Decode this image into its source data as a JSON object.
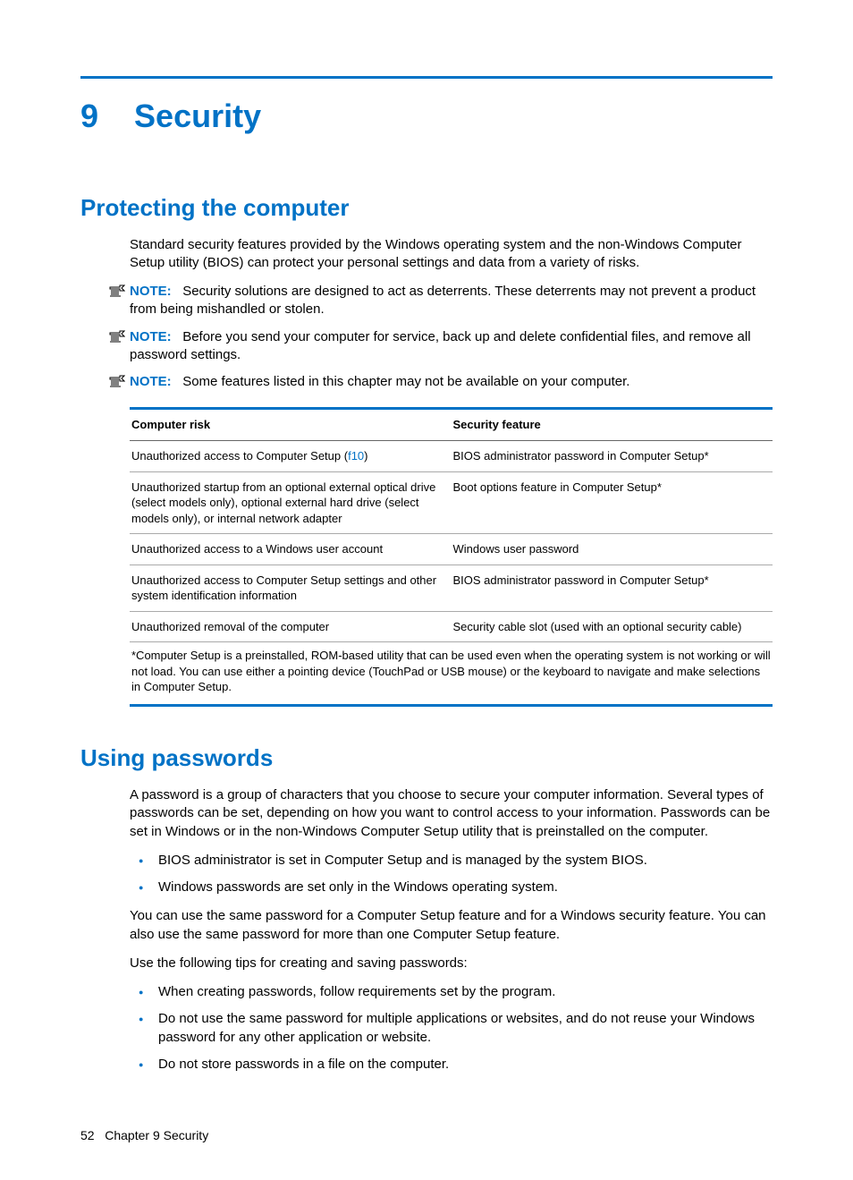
{
  "chapter": {
    "number": "9",
    "title": "Security"
  },
  "section1": {
    "heading": "Protecting the computer",
    "intro": "Standard security features provided by the Windows operating system and the non-Windows Computer Setup utility (BIOS) can protect your personal settings and data from a variety of risks.",
    "notes": [
      {
        "label": "NOTE:",
        "text": "Security solutions are designed to act as deterrents. These deterrents may not prevent a product from being mishandled or stolen."
      },
      {
        "label": "NOTE:",
        "text": "Before you send your computer for service, back up and delete confidential files, and remove all password settings."
      },
      {
        "label": "NOTE:",
        "text": "Some features listed in this chapter may not be available on your computer."
      }
    ],
    "table": {
      "headers": [
        "Computer risk",
        "Security feature"
      ],
      "rows": [
        {
          "risk_pre": "Unauthorized access to Computer Setup (",
          "risk_key": "f10",
          "risk_post": ")",
          "feature": "BIOS administrator password in Computer Setup*"
        },
        {
          "risk": "Unauthorized startup from an optional external optical drive (select models only), optional external hard drive (select models only), or internal network adapter",
          "feature": "Boot options feature in Computer Setup*"
        },
        {
          "risk": "Unauthorized access to a Windows user account",
          "feature": "Windows user password"
        },
        {
          "risk": "Unauthorized access to Computer Setup settings and other system identification information",
          "feature": "BIOS administrator password in Computer Setup*"
        },
        {
          "risk": "Unauthorized removal of the computer",
          "feature": "Security cable slot (used with an optional security cable)"
        }
      ],
      "footnote": "*Computer Setup is a preinstalled, ROM-based utility that can be used even when the operating system is not working or will not load. You can use either a pointing device (TouchPad or USB mouse) or the keyboard to navigate and make selections in Computer Setup."
    }
  },
  "section2": {
    "heading": "Using passwords",
    "p1": "A password is a group of characters that you choose to secure your computer information. Several types of passwords can be set, depending on how you want to control access to your information. Passwords can be set in Windows or in the non-Windows Computer Setup utility that is preinstalled on the computer.",
    "list1": [
      "BIOS administrator is set in Computer Setup and is managed by the system BIOS.",
      "Windows passwords are set only in the Windows operating system."
    ],
    "p2": "You can use the same password for a Computer Setup feature and for a Windows security feature. You can also use the same password for more than one Computer Setup feature.",
    "p3": "Use the following tips for creating and saving passwords:",
    "list2": [
      "When creating passwords, follow requirements set by the program.",
      "Do not use the same password for multiple applications or websites, and do not reuse your Windows password for any other application or website.",
      "Do not store passwords in a file on the computer."
    ]
  },
  "footer": {
    "page": "52",
    "label": "Chapter 9   Security"
  }
}
